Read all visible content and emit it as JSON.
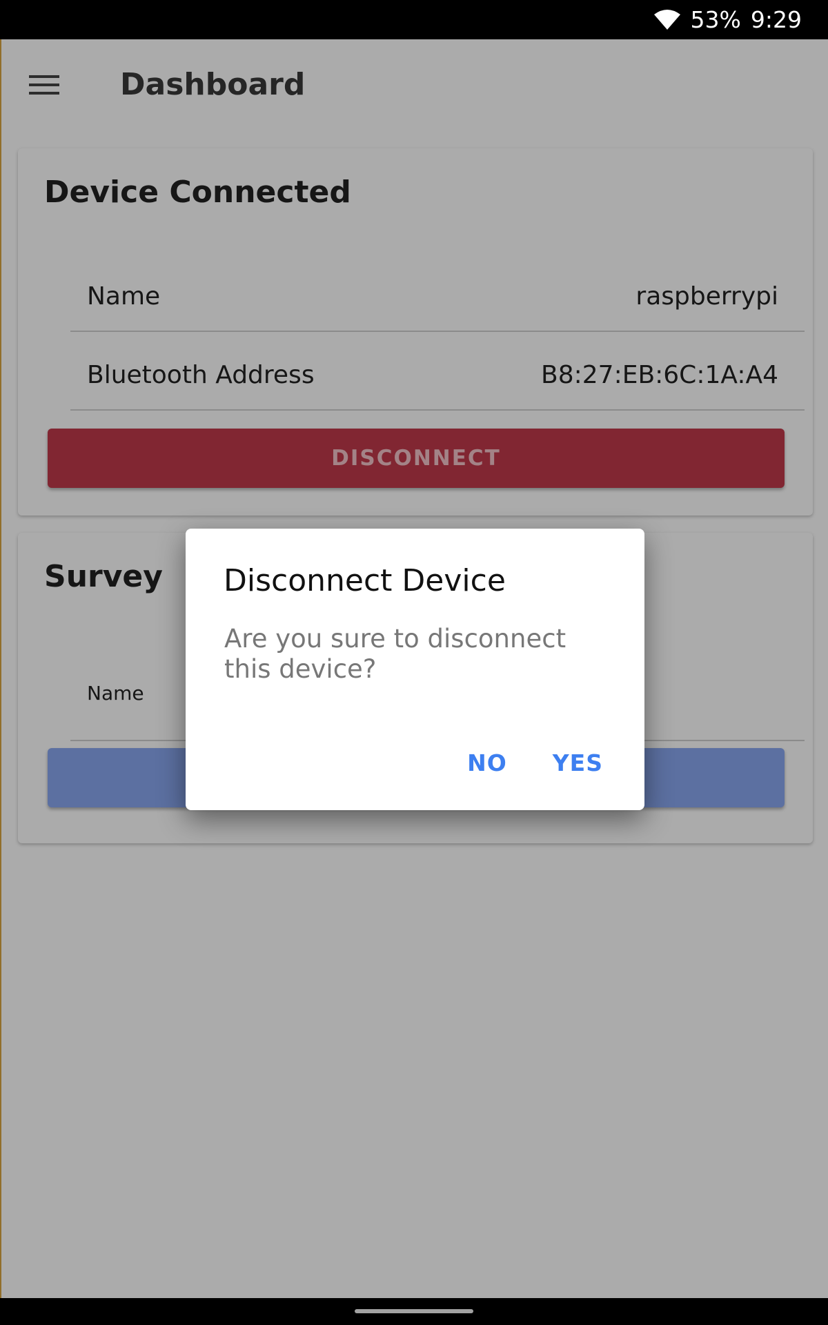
{
  "status_bar": {
    "battery": "53%",
    "time": "9:29",
    "wifi_icon": "wifi-icon"
  },
  "app_bar": {
    "title": "Dashboard",
    "menu_icon": "menu-icon"
  },
  "device_card": {
    "title": "Device Connected",
    "rows": [
      {
        "label": "Name",
        "value": "raspberrypi"
      },
      {
        "label": "Bluetooth Address",
        "value": "B8:27:EB:6C:1A:A4"
      }
    ],
    "disconnect_label": "DISCONNECT"
  },
  "survey_card": {
    "title": "Survey",
    "rows": [
      {
        "label": "Name",
        "value": ""
      }
    ],
    "button_label": ""
  },
  "dialog": {
    "title": "Disconnect Device",
    "message": "Are you sure to disconnect this device?",
    "no_label": "NO",
    "yes_label": "YES"
  },
  "colors": {
    "disconnect_button": "#c0394b",
    "survey_button": "#8aa8f0",
    "dialog_action": "#3d7ff0",
    "scrim": "rgba(0,0,0,0.33)"
  }
}
